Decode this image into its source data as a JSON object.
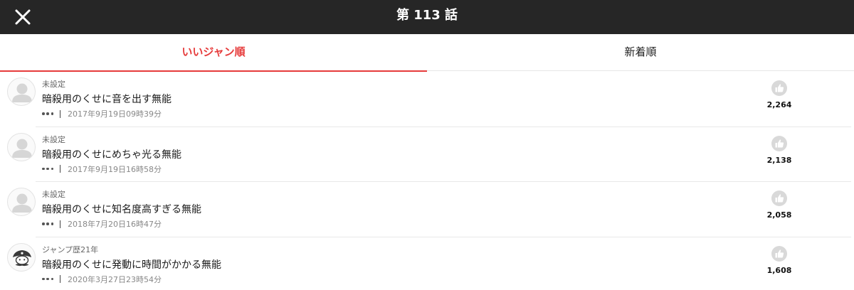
{
  "header": {
    "title": "第 113 話",
    "close_icon": "close-icon"
  },
  "tabs": [
    {
      "label": "いいジャン順",
      "active": true
    },
    {
      "label": "新着順",
      "active": false
    }
  ],
  "colors": {
    "accent": "#e63b3b",
    "header_bg": "#262626"
  },
  "comments": [
    {
      "user": "未設定",
      "text": "暗殺用のくせに音を出す無能",
      "date": "2017年9月19日09時39分",
      "likes": "2,264",
      "avatar": "default-avatar"
    },
    {
      "user": "未設定",
      "text": "暗殺用のくせにめちゃ光る無能",
      "date": "2017年9月19日16時58分",
      "likes": "2,138",
      "avatar": "default-avatar"
    },
    {
      "user": "未設定",
      "text": "暗殺用のくせに知名度高すぎる無能",
      "date": "2018年7月20日16時47分",
      "likes": "2,058",
      "avatar": "default-avatar"
    },
    {
      "user": "ジャンプ歴21年",
      "text": "暗殺用のくせに発動に時間がかかる無能",
      "date": "2020年3月27日23時54分",
      "likes": "1,608",
      "avatar": "pirate-avatar"
    }
  ]
}
